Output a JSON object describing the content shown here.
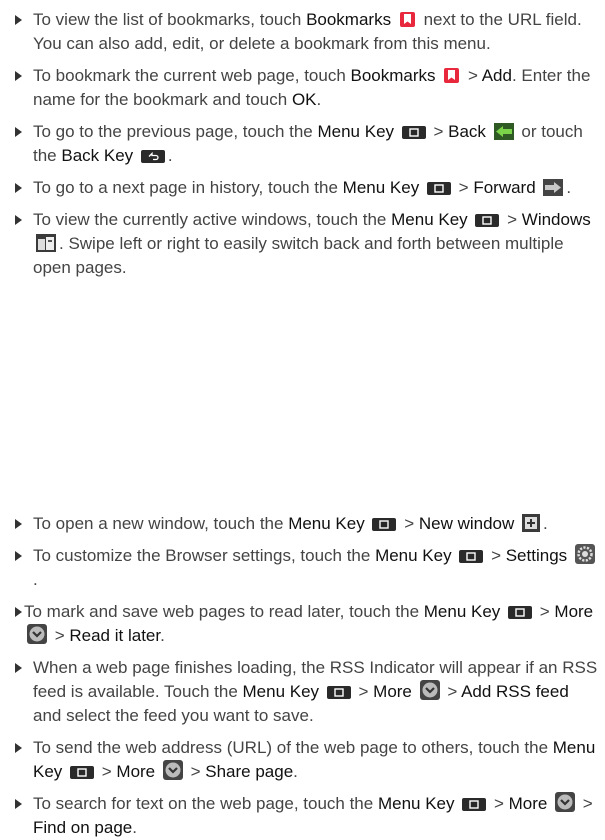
{
  "items": [
    {
      "parts": [
        "To view the list of bookmarks, touch ",
        "Bookmarks",
        " next to the URL field. You can also add, edit, or delete a bookmark from this menu."
      ]
    },
    {
      "parts": [
        "To bookmark the current web page, touch ",
        "Bookmarks",
        " > ",
        "Add",
        ". Enter the name for the bookmark and touch ",
        "OK",
        "."
      ]
    },
    {
      "parts": [
        "To go to the previous page, touch the ",
        "Menu Key",
        " > ",
        "Back",
        " or touch the ",
        "Back Key",
        "."
      ]
    },
    {
      "parts": [
        "To go to a next page in history, touch the ",
        "Menu Key",
        " > ",
        "Forward",
        "."
      ]
    },
    {
      "parts": [
        "To view the currently active windows, touch the ",
        "Menu Key",
        " > ",
        "Windows",
        ". Swipe left or right to easily switch back and forth between multiple open pages."
      ]
    },
    {
      "parts": [
        "To open a new window, touch the ",
        "Menu Key",
        " > ",
        "New window",
        "."
      ]
    },
    {
      "parts": [
        "To customize the Browser settings, touch the ",
        "Menu Key",
        " > ",
        "Settings",
        "."
      ]
    },
    {
      "parts": [
        "To mark and save web pages to read later, touch the ",
        "Menu Key",
        " > ",
        "More",
        " > ",
        "Read it later",
        "."
      ]
    },
    {
      "parts": [
        "When a web page finishes loading, the RSS Indicator will appear if an RSS feed is available. Touch the ",
        "Menu Key",
        " > ",
        "More",
        " > ",
        "Add RSS feed",
        " and select the feed you want to save."
      ]
    },
    {
      "parts": [
        "To send the web address (URL) of the web page to others, touch the ",
        "Menu Key",
        " > ",
        "More",
        " > ",
        "Share page",
        "."
      ]
    },
    {
      "parts": [
        "To search for text on the web page, touch the ",
        "Menu Key",
        " > ",
        "More",
        " > ",
        "Find on page",
        "."
      ]
    }
  ],
  "icons": {
    "bookmark": "bookmark-icon",
    "menu_key": "menu-key-icon",
    "back": "back-arrow-icon",
    "back_key": "back-key-icon",
    "forward": "forward-arrow-icon",
    "windows": "windows-icon",
    "new_window": "new-window-icon",
    "settings": "settings-gear-icon",
    "more": "more-chevron-icon",
    "bookmark_color": "#e8283c",
    "key_color": "#2a2a2a"
  }
}
